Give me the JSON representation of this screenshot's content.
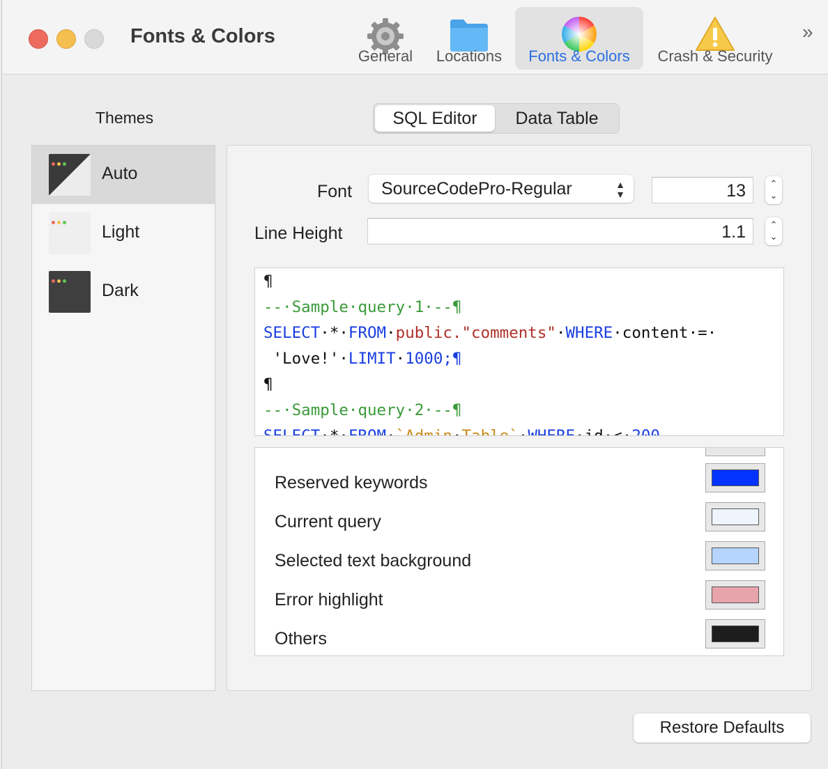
{
  "window": {
    "title": "Fonts & Colors"
  },
  "toolbar": {
    "items": [
      {
        "label": "General",
        "icon": "gear-icon"
      },
      {
        "label": "Locations",
        "icon": "folder-icon"
      },
      {
        "label": "Fonts & Colors",
        "icon": "color-wheel-icon",
        "active": true
      },
      {
        "label": "Crash & Security",
        "icon": "warning-icon"
      }
    ],
    "overflow": "»"
  },
  "themes": {
    "title": "Themes",
    "items": [
      {
        "label": "Auto",
        "selected": true
      },
      {
        "label": "Light"
      },
      {
        "label": "Dark"
      }
    ]
  },
  "tabs": [
    {
      "label": "SQL Editor",
      "active": true
    },
    {
      "label": "Data Table"
    }
  ],
  "font": {
    "label": "Font",
    "value": "SourceCodePro-Regular",
    "size": "13",
    "line_height_label": "Line  Height",
    "line_height": "1.1"
  },
  "editor": {
    "lines": [
      "¶",
      "--·Sample·query·1·--¶",
      "SELECT·*·FROM·public.\"comments\"·WHERE·content·=·",
      "'Love!'·LIMIT·1000;¶",
      "¶",
      "--·Sample·query·2·--¶",
      "SELECT·*·FROM·`Admin·Table`·WHERE·id·<·200"
    ]
  },
  "colors": {
    "items": [
      {
        "label": "Reserved keywords",
        "color": "#0433ff"
      },
      {
        "label": "Current query",
        "color": "#eef5fd"
      },
      {
        "label": "Selected text background",
        "color": "#b5d5ff"
      },
      {
        "label": "Error highlight",
        "color": "#e8a4ab"
      },
      {
        "label": "Others",
        "color": "#1d1d1d"
      }
    ]
  },
  "restore_label": "Restore Defaults"
}
